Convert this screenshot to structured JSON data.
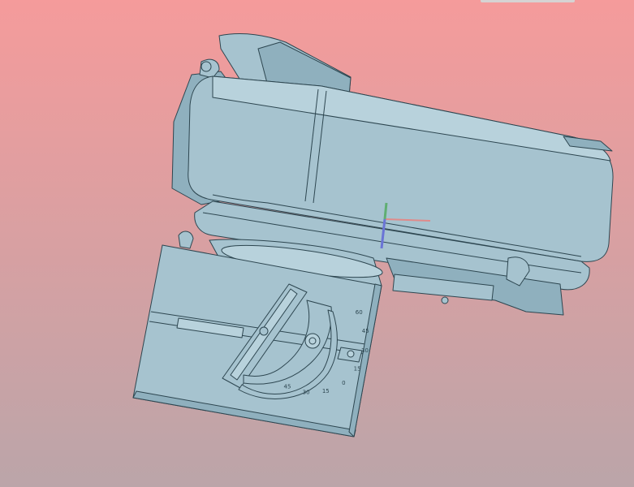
{
  "viewport": {
    "background_top": "#f59b9b",
    "background_bottom": "#bba5a9",
    "model_fill": "#a6c3cf",
    "model_fill_dark": "#8fb0be",
    "model_fill_light": "#b8d2dc",
    "edge_color": "#2d4650"
  },
  "protractor_labels": [
    "45",
    "30",
    "15",
    "0",
    "15",
    "30",
    "45",
    "60"
  ],
  "triad": {
    "x_color": "#e08a8a",
    "y_color": "#5fae72",
    "z_color": "#6a74d6"
  }
}
